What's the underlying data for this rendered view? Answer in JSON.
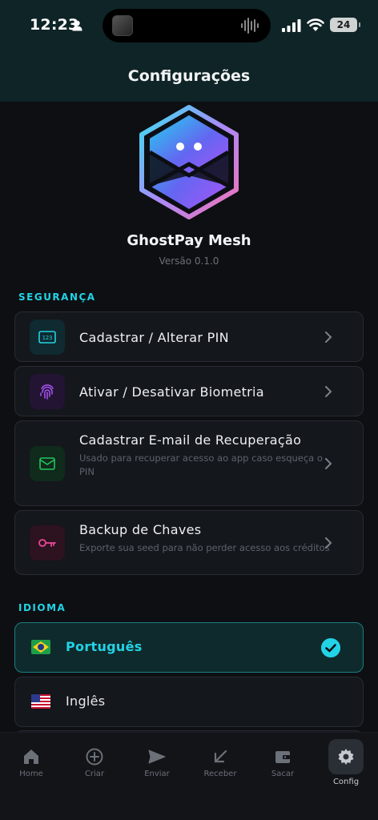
{
  "status_bar": {
    "time": "12:23",
    "battery": "24"
  },
  "header": {
    "title": "Configurações"
  },
  "app": {
    "name": "GhostPay Mesh",
    "version": "Versão 0.1.0"
  },
  "security": {
    "title": "SEGURANÇA",
    "items": [
      {
        "label": "Cadastrar / Alterar PIN",
        "desc": "",
        "icon": "pin-icon",
        "color": "#22d3e6"
      },
      {
        "label": "Ativar / Desativar Biometria",
        "desc": "",
        "icon": "fingerprint-icon",
        "color": "#a855f7"
      },
      {
        "label": "Cadastrar E-mail de Recuperação",
        "desc": "Usado para recuperar acesso ao app caso esqueça o PIN",
        "icon": "mail-icon",
        "color": "#22c55e"
      },
      {
        "label": "Backup de Chaves",
        "desc": "Exporte sua seed para não perder acesso aos créditos",
        "icon": "key-icon",
        "color": "#ec4899"
      }
    ]
  },
  "language": {
    "title": "IDIOMA",
    "options": [
      {
        "label": "Português",
        "flag": "flag-brazil",
        "selected": true
      },
      {
        "label": "Inglês",
        "flag": "flag-usa",
        "selected": false
      }
    ]
  },
  "tabbar": {
    "tabs": [
      {
        "label": "Home",
        "icon": "home-icon"
      },
      {
        "label": "Criar",
        "icon": "plus-circle-icon"
      },
      {
        "label": "Enviar",
        "icon": "send-icon"
      },
      {
        "label": "Receber",
        "icon": "arrow-down-left-icon"
      },
      {
        "label": "Sacar",
        "icon": "wallet-icon"
      },
      {
        "label": "Config",
        "icon": "gear-icon",
        "active": true
      }
    ]
  },
  "colors": {
    "accent": "#22d3e6",
    "background": "#0d0f12",
    "header": "#0f2426"
  }
}
